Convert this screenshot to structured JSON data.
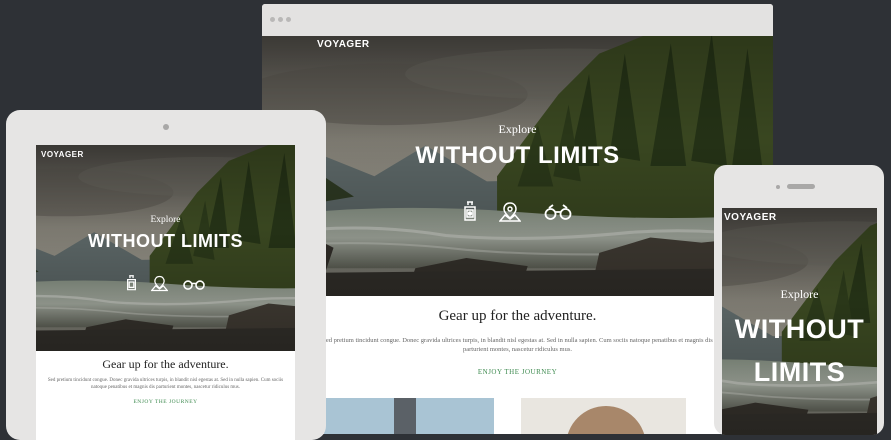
{
  "site": {
    "logo": "VOYAGER",
    "hero_kicker": "Explore",
    "hero_title": "WITHOUT LIMITS",
    "hero_title_line1": "WITHOUT",
    "hero_title_line2": "LIMITS",
    "icons": [
      "lantern-icon",
      "map-pin-icon",
      "binoculars-icon"
    ]
  },
  "content": {
    "heading": "Gear up for the adventure.",
    "paragraph": "Sed pretium tincidunt congue. Donec gravida ultrices turpis, in blandit nisl egestas at. Sed in nulla sapien. Cum sociis natoque penatibus et magnis dis parturient montes, nascetur ridiculus mus.",
    "paragraph_tablet": "Sed pretium tincidunt congue. Donec gravida ultrices turpis, in blandit nisl egestas at. Sed in nulla sapien. Cum sociis natoque penatibus et magnis dis parturient montes, nascetur ridiculus mus.",
    "cta": "ENJOY THE JOURNEY"
  },
  "colors": {
    "background": "#2e3136",
    "device_frame": "#e3e2e1",
    "cta_green": "#3d8a4f"
  }
}
